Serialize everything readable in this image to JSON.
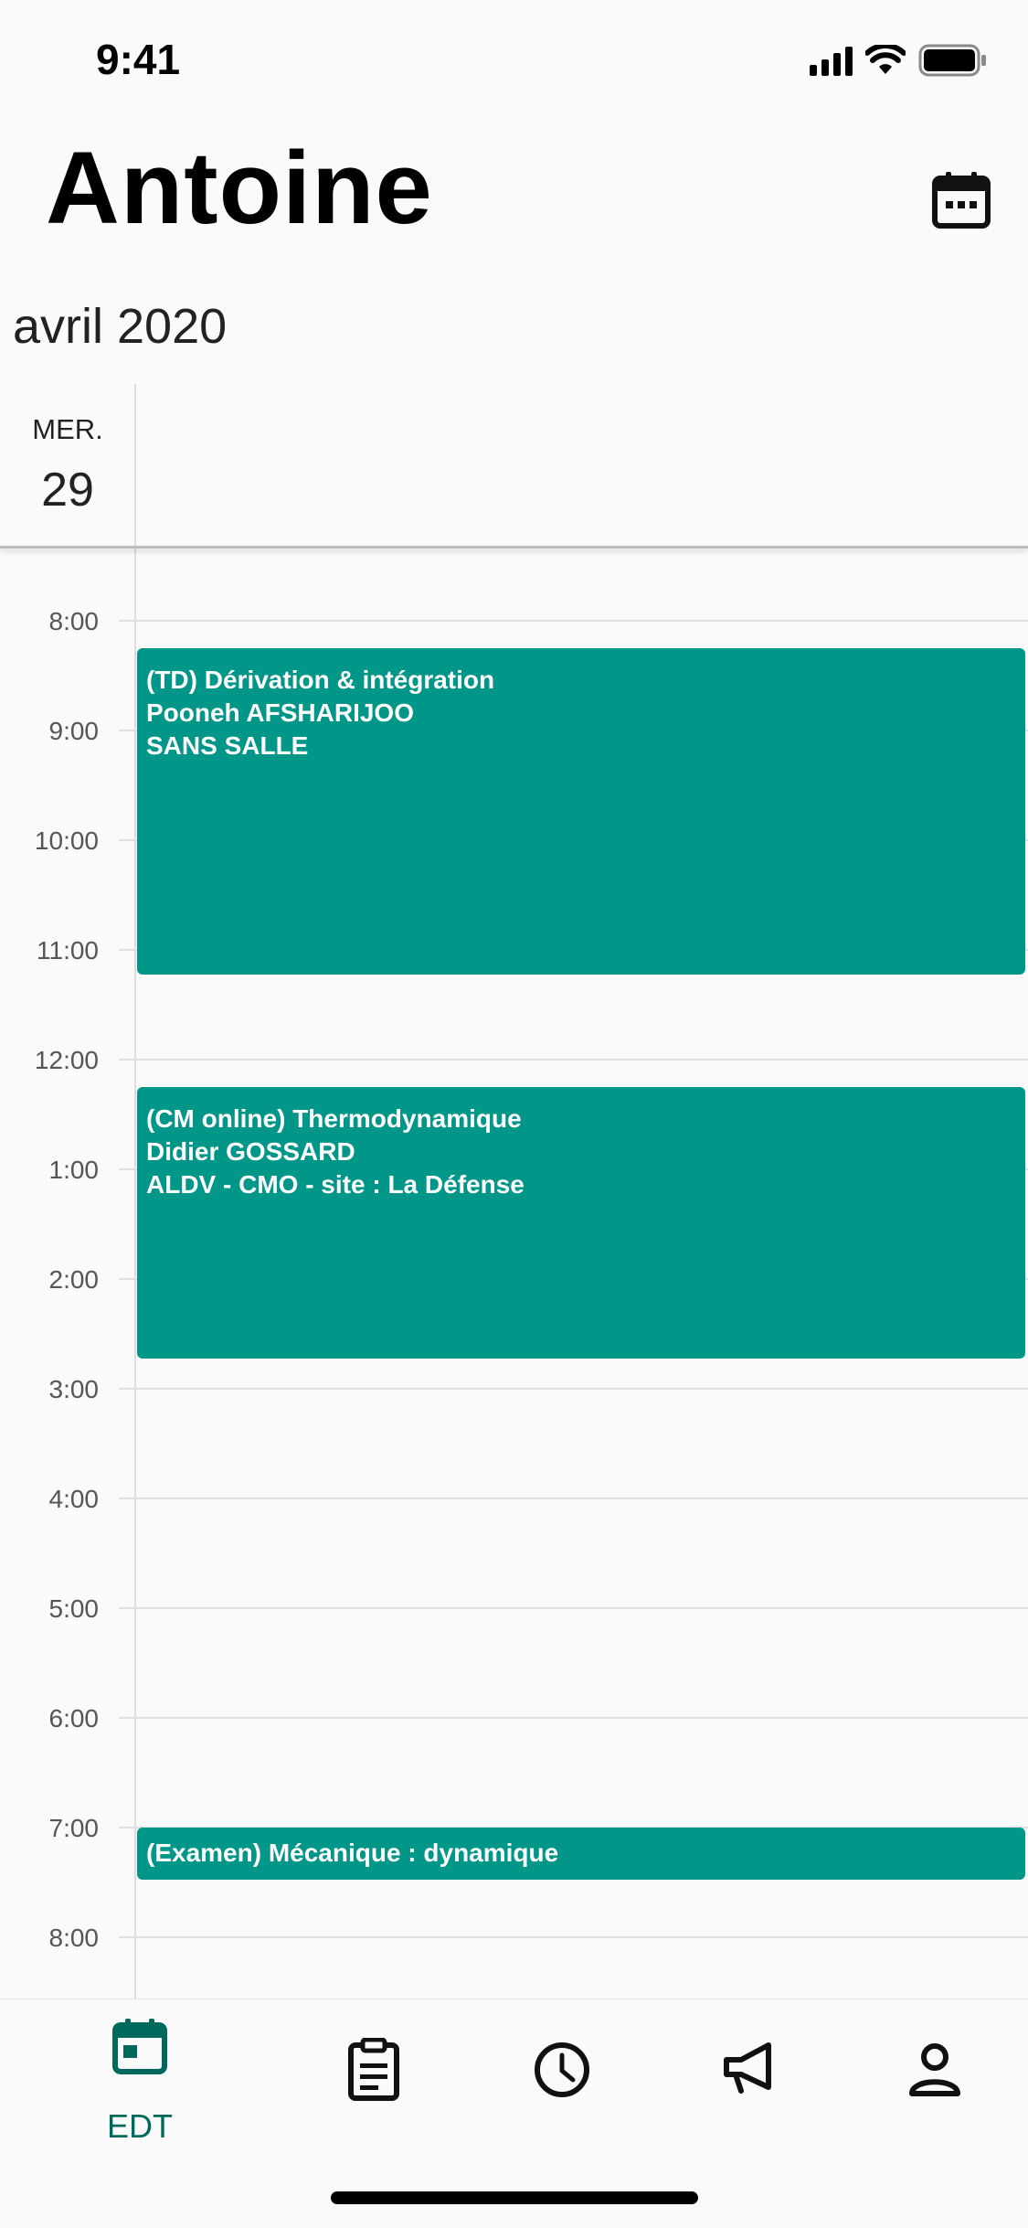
{
  "status_bar": {
    "time": "9:41"
  },
  "header": {
    "title": "Antoine",
    "calendar_icon": "calendar-icon"
  },
  "month": "avril 2020",
  "day": {
    "name": "MER.",
    "number": "29"
  },
  "hours": [
    "8:00",
    "9:00",
    "10:00",
    "11:00",
    "12:00",
    "1:00",
    "2:00",
    "3:00",
    "4:00",
    "5:00",
    "6:00",
    "7:00",
    "8:00"
  ],
  "events": [
    {
      "line1": "(TD) Dérivation & intégration",
      "line2": "Pooneh AFSHARIJOO",
      "line3": "SANS SALLE"
    },
    {
      "line1": "(CM online) Thermodynamique",
      "line2": "Didier GOSSARD",
      "line3": "ALDV - CMO - site : La Défense"
    },
    {
      "line1": "(Examen) Mécanique : dynamique"
    }
  ],
  "tabs": [
    {
      "label": "EDT",
      "icon": "calendar-icon",
      "active": true
    },
    {
      "icon": "clipboard-icon"
    },
    {
      "icon": "clock-icon"
    },
    {
      "icon": "megaphone-icon"
    },
    {
      "icon": "person-icon"
    }
  ],
  "colors": {
    "accent": "#009688",
    "active_tab": "#00695c",
    "background": "#fafafa"
  }
}
